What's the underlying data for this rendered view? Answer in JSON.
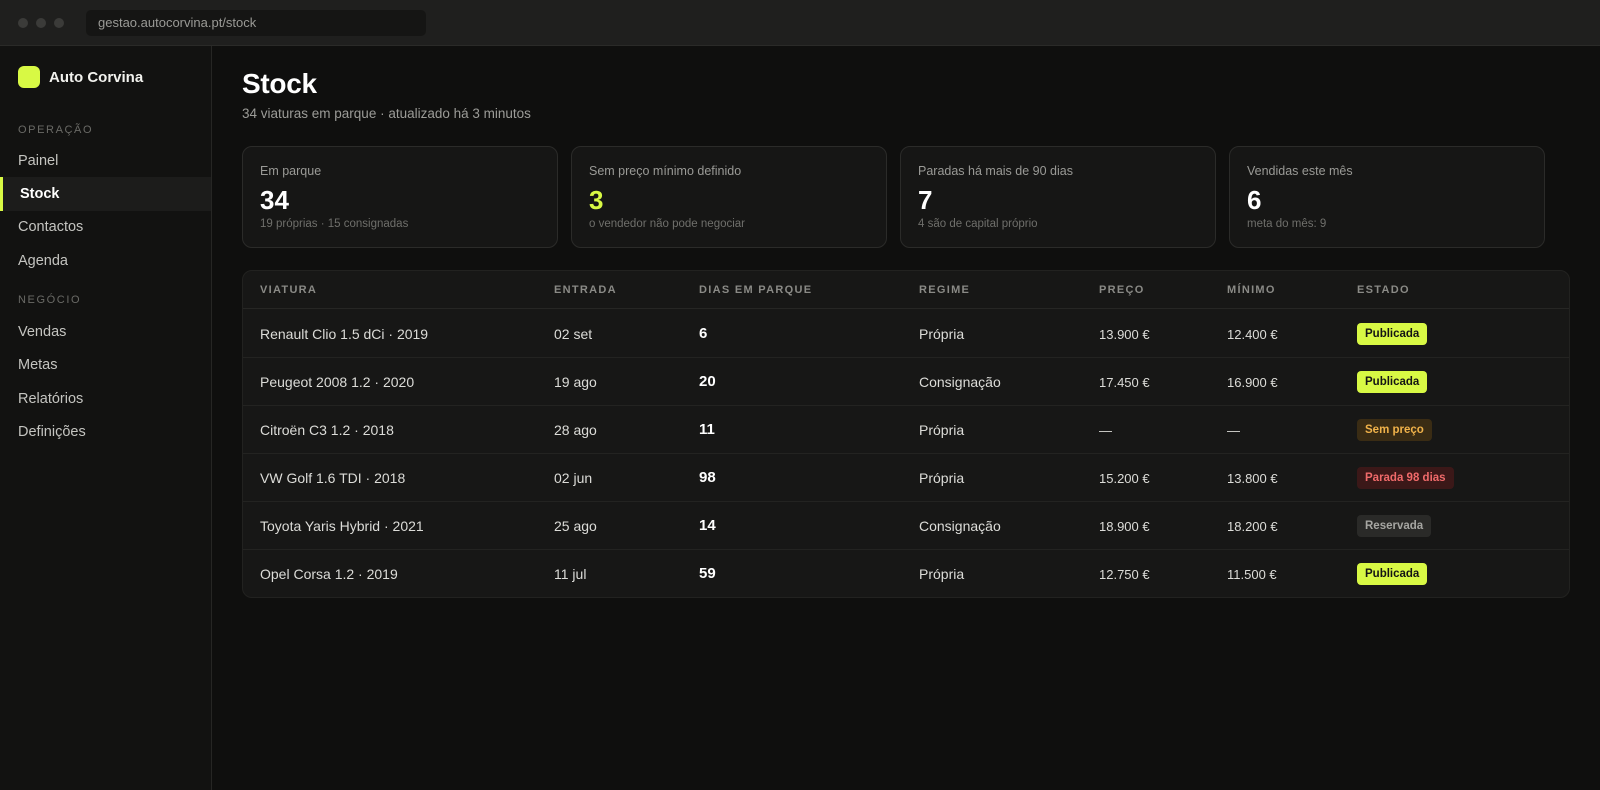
{
  "browser": {
    "url": "gestao.autocorvina.pt/stock"
  },
  "brand": {
    "name": "Auto Corvina"
  },
  "sidebar": {
    "section_ops": "OPERAÇÃO",
    "section_business": "NEGÓCIO",
    "items": [
      {
        "label": "Painel"
      },
      {
        "label": "Stock"
      },
      {
        "label": "Contactos"
      },
      {
        "label": "Agenda"
      },
      {
        "label": "Vendas"
      },
      {
        "label": "Metas"
      },
      {
        "label": "Relatórios"
      },
      {
        "label": "Definições"
      }
    ]
  },
  "page": {
    "title": "Stock",
    "subtitle": "34 viaturas em parque · atualizado há 3 minutos"
  },
  "cards": [
    {
      "label": "Em parque",
      "value": "34",
      "note": "19 próprias · 15 consignadas"
    },
    {
      "label": "Sem preço mínimo definido",
      "value": "3",
      "note": "o vendedor não pode negociar"
    },
    {
      "label": "Paradas há mais de 90 dias",
      "value": "7",
      "note": "4 são de capital próprio"
    },
    {
      "label": "Vendidas este mês",
      "value": "6",
      "note": "meta do mês: 9"
    }
  ],
  "table": {
    "headers": [
      "VIATURA",
      "ENTRADA",
      "DIAS EM PARQUE",
      "REGIME",
      "PREÇO",
      "MÍNIMO",
      "ESTADO"
    ],
    "rows": [
      {
        "vehicle": "Renault Clio 1.5 dCi · 2019",
        "entry": "02 set",
        "days": "6",
        "regime": "Própria",
        "price": "13.900 €",
        "min": "12.400 €",
        "status": "Publicada"
      },
      {
        "vehicle": "Peugeot 2008 1.2 · 2020",
        "entry": "19 ago",
        "days": "20",
        "regime": "Consignação",
        "price": "17.450 €",
        "min": "16.900 €",
        "status": "Publicada"
      },
      {
        "vehicle": "Citroën C3 1.2 · 2018",
        "entry": "28 ago",
        "days": "11",
        "regime": "Própria",
        "price": "—",
        "min": "—",
        "status": "Sem preço"
      },
      {
        "vehicle": "VW Golf 1.6 TDI · 2018",
        "entry": "02 jun",
        "days": "98",
        "regime": "Própria",
        "price": "15.200 €",
        "min": "13.800 €",
        "status": "Parada 98 dias"
      },
      {
        "vehicle": "Toyota Yaris Hybrid · 2021",
        "entry": "25 ago",
        "days": "14",
        "regime": "Consignação",
        "price": "18.900 €",
        "min": "18.200 €",
        "status": "Reservada"
      },
      {
        "vehicle": "Opel Corsa 1.2 · 2019",
        "entry": "11 jul",
        "days": "59",
        "regime": "Própria",
        "price": "12.750 €",
        "min": "11.500 €",
        "status": "Publicada"
      }
    ]
  },
  "colors": {
    "accent": "#d8f944",
    "background": "#0f0f0e",
    "warning": "#f0b24a",
    "danger": "#f06a6a"
  }
}
